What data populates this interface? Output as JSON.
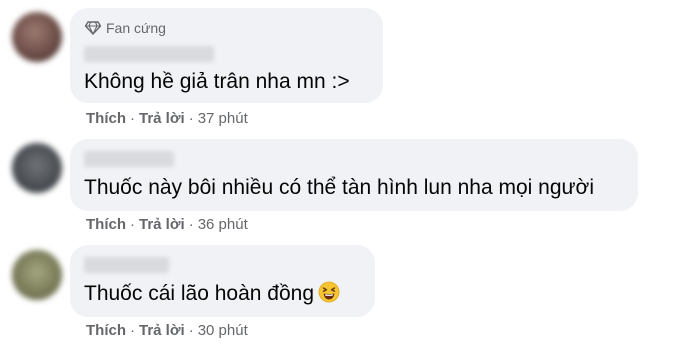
{
  "comments": [
    {
      "badge": "Fan cứng",
      "text": "Không hề giả trân nha mn :>",
      "like_label": "Thích",
      "reply_label": "Trả lời",
      "time": "37 phút"
    },
    {
      "text": "Thuốc này bôi nhiều có thể tàn hình lun nha mọi người",
      "like_label": "Thích",
      "reply_label": "Trả lời",
      "time": "36 phút"
    },
    {
      "text": "Thuốc cái lão hoàn đồng",
      "emoji": "grinning-squinting-face",
      "like_label": "Thích",
      "reply_label": "Trả lời",
      "time": "30 phút"
    }
  ],
  "colors": {
    "bubble": "#f0f2f5",
    "text": "#050505",
    "secondary": "#65676b",
    "emoji": "#f7c531"
  }
}
